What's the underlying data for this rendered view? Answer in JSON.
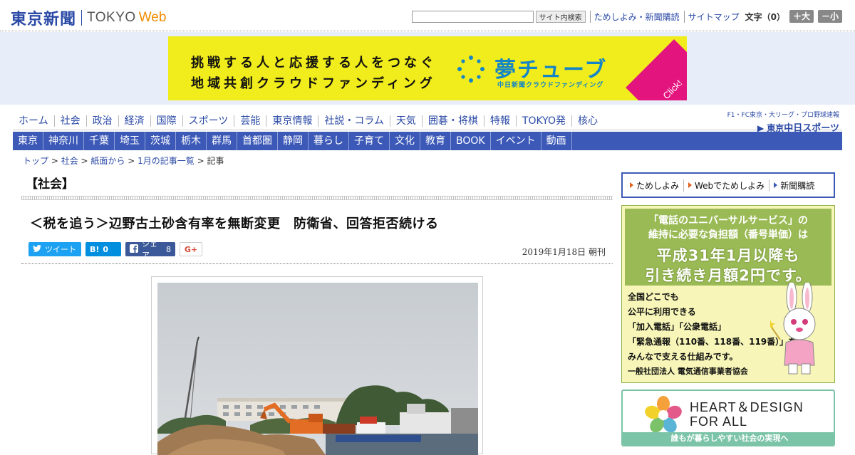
{
  "header": {
    "logo_jp": "東京新聞",
    "logo_en": "TOKYO",
    "logo_web": "Web",
    "search_button": "サイト内検索",
    "links": [
      "ためしよみ・新聞購読",
      "サイトマップ"
    ],
    "fontsize_label": "文字（0）",
    "font_larger": "＋大",
    "font_smaller": "－小"
  },
  "banner": {
    "line1": "挑戦する人と応援する人をつなぐ",
    "line2": "地域共創クラウドファンディング",
    "title": "夢チューブ",
    "subtitle": "中日新聞クラウドファンディング",
    "click": "Click!"
  },
  "nav_primary": [
    "ホーム",
    "社会",
    "政治",
    "経済",
    "国際",
    "スポーツ",
    "芸能",
    "東京情報",
    "社説・コラム",
    "天気",
    "囲碁・将棋",
    "特報",
    "TOKYO発",
    "核心"
  ],
  "chunichi_sports": {
    "sub": "F1・FC東京・大リーグ・プロ野球速報",
    "main_prefix": "東京",
    "main": "中日スポーツ"
  },
  "nav_secondary": [
    "東京",
    "神奈川",
    "千葉",
    "埼玉",
    "茨城",
    "栃木",
    "群馬",
    "首都圏",
    "静岡",
    "暮らし",
    "子育て",
    "文化",
    "教育",
    "BOOK",
    "イベント",
    "動画"
  ],
  "breadcrumb": {
    "items": [
      "トップ",
      "社会",
      "紙面から",
      "1月の記事一覧"
    ],
    "current": "記事",
    "separator": " > "
  },
  "article": {
    "section": "【社会】",
    "headline": "＜税を追う＞辺野古土砂含有率を無断変更　防衛省、回答拒否続ける",
    "date": "2019年1月18日 朝刊",
    "social": {
      "tweet": "ツイート",
      "hatena_icon": "B!",
      "hatena_count": "0",
      "facebook": "シェア",
      "facebook_count": "8",
      "gplus": "G+"
    }
  },
  "sidebar": {
    "links": [
      "ためしよみ",
      "Webでためしよみ",
      "新聞購読"
    ],
    "ad_universal": {
      "line1": "「電話のユニバーサルサービス」の",
      "line2": "維持に必要な負担額（番号単価）は",
      "big1": "平成31年1月以降も",
      "big2": "引き続き月額2円です。",
      "body": [
        "全国どこでも",
        "公平に利用できる",
        "「加入電話」「公衆電話」",
        "「緊急通報（110番、118番、119番）」を",
        "みんなで支える仕組みです。"
      ],
      "org": "一般社団法人 電気通信事業者協会"
    },
    "ad_heart": {
      "line1": "HEART＆DESIGN",
      "line2": "FOR ALL",
      "footer": "誰もが暮らしやすい社会の実現へ"
    }
  },
  "colors": {
    "brand_blue": "#2b4aa6",
    "nav_blue": "#3c59b8",
    "banner_yellow": "#f1ec1b",
    "accent_orange": "#f08c00"
  }
}
